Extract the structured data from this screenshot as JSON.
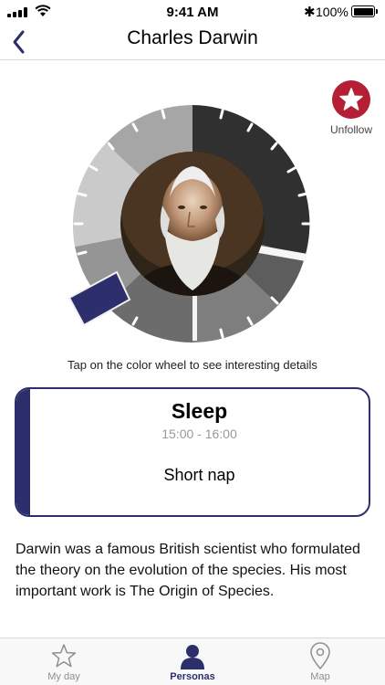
{
  "status_bar": {
    "time": "9:41 AM",
    "battery": "100%"
  },
  "nav": {
    "title": "Charles Darwin"
  },
  "unfollow": {
    "label": "Unfollow"
  },
  "hint": "Tap on the color wheel to see interesting details",
  "activity": {
    "title": "Sleep",
    "time": "15:00 - 16:00",
    "description": "Short nap"
  },
  "bio": "Darwin was a famous British scientist who formulated the theory on the evolution of the species. His most important work is The Origin of Species.",
  "tabs": [
    {
      "label": "My day",
      "icon": "star-outline-icon",
      "active": false
    },
    {
      "label": "Personas",
      "icon": "person-icon",
      "active": true
    },
    {
      "label": "Map",
      "icon": "map-pin-icon",
      "active": false
    }
  ],
  "colors": {
    "accent": "#2c2f6b",
    "unfollow": "#b51f35"
  }
}
